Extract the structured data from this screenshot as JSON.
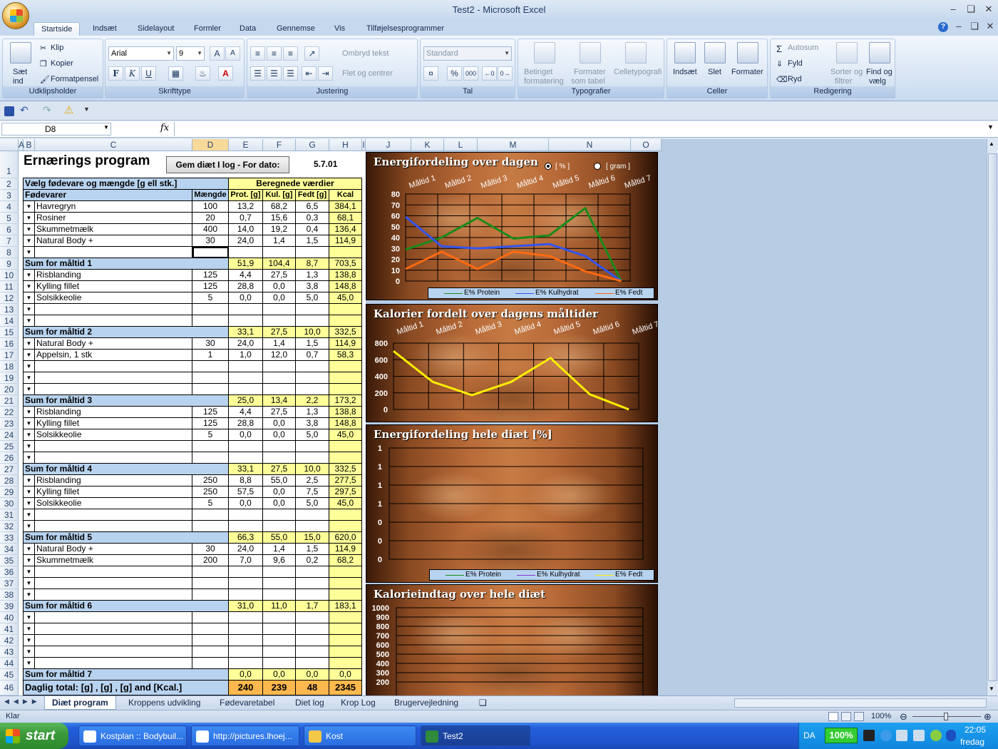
{
  "window": {
    "title": "Test2 - Microsoft Excel"
  },
  "ribbon_tabs": [
    "Startside",
    "Indsæt",
    "Sidelayout",
    "Formler",
    "Data",
    "Gennemse",
    "Vis",
    "Tilføjelsesprogrammer"
  ],
  "ribbon": {
    "clipboard": {
      "paste": "Sæt",
      "paste2": "ind",
      "cut": "Klip",
      "copy": "Kopier",
      "format_painter": "Formatpensel",
      "label": "Udklipsholder"
    },
    "font": {
      "name": "Arial",
      "size": "9",
      "label": "Skrifttype",
      "bold": "F",
      "italic": "K",
      "underline": "U",
      "font_color": "A"
    },
    "alignment": {
      "wrap": "Ombryd tekst",
      "merge": "Flet og centrer",
      "label": "Justering"
    },
    "number": {
      "format": "Standard",
      "label": "Tal",
      "percent": "%",
      "thousands": "000"
    },
    "styles": {
      "cond1": "Betinget",
      "cond2": "formatering",
      "table1": "Formater",
      "table2": "som tabel",
      "cell1": "Celletypografi",
      "label": "Typografier"
    },
    "cells": {
      "insert": "Indsæt",
      "delete": "Slet",
      "format": "Formater",
      "label": "Celler"
    },
    "editing": {
      "autosum": "Autosum",
      "fill": "Fyld",
      "clear": "Ryd",
      "sort1": "Sorter og",
      "sort2": "filtrer",
      "find1": "Find og",
      "find2": "vælg",
      "label": "Redigering",
      "sigma": "Σ"
    }
  },
  "namebox": "D8",
  "fx": "fx",
  "columns": [
    "A",
    "B",
    "C",
    "D",
    "E",
    "F",
    "G",
    "H",
    "I",
    "J",
    "K",
    "L",
    "M",
    "N",
    "O"
  ],
  "sheet": {
    "title": "Ernærings program",
    "button": "Gem diæt I log - For dato:",
    "date": "5.7.01",
    "r2_left": "Vælg fødevare og mængde [g ell stk.]",
    "r2_right": "Beregnede værdier",
    "hdr": [
      "Fødevarer",
      "Mængde",
      "Prot. [g]",
      "Kul. [g]",
      "Fedt [g]",
      "Kcal"
    ],
    "rows": [
      {
        "r": "4",
        "t": "f",
        "c": [
          "Havregryn",
          "100",
          "13,2",
          "68,2",
          "6,5",
          "384,1"
        ]
      },
      {
        "r": "5",
        "t": "f",
        "c": [
          "Rosiner",
          "20",
          "0,7",
          "15,6",
          "0,3",
          "68,1"
        ]
      },
      {
        "r": "6",
        "t": "f",
        "c": [
          "Skummetmælk",
          "400",
          "14,0",
          "19,2",
          "0,4",
          "136,4"
        ]
      },
      {
        "r": "7",
        "t": "f",
        "c": [
          "Natural Body +",
          "30",
          "24,0",
          "1,4",
          "1,5",
          "114,9"
        ]
      },
      {
        "r": "8",
        "t": "f",
        "c": [
          "",
          "",
          "",
          "",
          "",
          ""
        ]
      },
      {
        "r": "9",
        "t": "s",
        "c": [
          "Sum for måltid 1",
          "",
          "51,9",
          "104,4",
          "8,7",
          "703,5"
        ]
      },
      {
        "r": "10",
        "t": "f",
        "c": [
          "Risblanding",
          "125",
          "4,4",
          "27,5",
          "1,3",
          "138,8"
        ]
      },
      {
        "r": "11",
        "t": "f",
        "c": [
          "Kylling fillet",
          "125",
          "28,8",
          "0,0",
          "3,8",
          "148,8"
        ]
      },
      {
        "r": "12",
        "t": "f",
        "c": [
          "Solsikkeolie",
          "5",
          "0,0",
          "0,0",
          "5,0",
          "45,0"
        ]
      },
      {
        "r": "13",
        "t": "f",
        "c": [
          "",
          "",
          "",
          "",
          "",
          ""
        ]
      },
      {
        "r": "14",
        "t": "f",
        "c": [
          "",
          "",
          "",
          "",
          "",
          ""
        ]
      },
      {
        "r": "15",
        "t": "s",
        "c": [
          "Sum for måltid 2",
          "",
          "33,1",
          "27,5",
          "10,0",
          "332,5"
        ]
      },
      {
        "r": "16",
        "t": "f",
        "c": [
          "Natural Body +",
          "30",
          "24,0",
          "1,4",
          "1,5",
          "114,9"
        ]
      },
      {
        "r": "17",
        "t": "f",
        "c": [
          "Appelsin, 1 stk",
          "1",
          "1,0",
          "12,0",
          "0,7",
          "58,3"
        ]
      },
      {
        "r": "18",
        "t": "f",
        "c": [
          "",
          "",
          "",
          "",
          "",
          ""
        ]
      },
      {
        "r": "19",
        "t": "f",
        "c": [
          "",
          "",
          "",
          "",
          "",
          ""
        ]
      },
      {
        "r": "20",
        "t": "f",
        "c": [
          "",
          "",
          "",
          "",
          "",
          ""
        ]
      },
      {
        "r": "21",
        "t": "s",
        "c": [
          "Sum for måltid 3",
          "",
          "25,0",
          "13,4",
          "2,2",
          "173,2"
        ]
      },
      {
        "r": "22",
        "t": "f",
        "c": [
          "Risblanding",
          "125",
          "4,4",
          "27,5",
          "1,3",
          "138,8"
        ]
      },
      {
        "r": "23",
        "t": "f",
        "c": [
          "Kylling fillet",
          "125",
          "28,8",
          "0,0",
          "3,8",
          "148,8"
        ]
      },
      {
        "r": "24",
        "t": "f",
        "c": [
          "Solsikkeolie",
          "5",
          "0,0",
          "0,0",
          "5,0",
          "45,0"
        ]
      },
      {
        "r": "25",
        "t": "f",
        "c": [
          "",
          "",
          "",
          "",
          "",
          ""
        ]
      },
      {
        "r": "26",
        "t": "f",
        "c": [
          "",
          "",
          "",
          "",
          "",
          ""
        ]
      },
      {
        "r": "27",
        "t": "s",
        "c": [
          "Sum for måltid 4",
          "",
          "33,1",
          "27,5",
          "10,0",
          "332,5"
        ]
      },
      {
        "r": "28",
        "t": "f",
        "c": [
          "Risblanding",
          "250",
          "8,8",
          "55,0",
          "2,5",
          "277,5"
        ]
      },
      {
        "r": "29",
        "t": "f",
        "c": [
          "Kylling fillet",
          "250",
          "57,5",
          "0,0",
          "7,5",
          "297,5"
        ]
      },
      {
        "r": "30",
        "t": "f",
        "c": [
          "Solsikkeolie",
          "5",
          "0,0",
          "0,0",
          "5,0",
          "45,0"
        ]
      },
      {
        "r": "31",
        "t": "f",
        "c": [
          "",
          "",
          "",
          "",
          "",
          ""
        ]
      },
      {
        "r": "32",
        "t": "f",
        "c": [
          "",
          "",
          "",
          "",
          "",
          ""
        ]
      },
      {
        "r": "33",
        "t": "s",
        "c": [
          "Sum for måltid 5",
          "",
          "66,3",
          "55,0",
          "15,0",
          "620,0"
        ]
      },
      {
        "r": "34",
        "t": "f",
        "c": [
          "Natural Body +",
          "30",
          "24,0",
          "1,4",
          "1,5",
          "114,9"
        ]
      },
      {
        "r": "35",
        "t": "f",
        "c": [
          "Skummetmælk",
          "200",
          "7,0",
          "9,6",
          "0,2",
          "68,2"
        ]
      },
      {
        "r": "36",
        "t": "f",
        "c": [
          "",
          "",
          "",
          "",
          "",
          ""
        ]
      },
      {
        "r": "37",
        "t": "f",
        "c": [
          "",
          "",
          "",
          "",
          "",
          ""
        ]
      },
      {
        "r": "38",
        "t": "f",
        "c": [
          "",
          "",
          "",
          "",
          "",
          ""
        ]
      },
      {
        "r": "39",
        "t": "s",
        "c": [
          "Sum for måltid 6",
          "",
          "31,0",
          "11,0",
          "1,7",
          "183,1"
        ]
      },
      {
        "r": "40",
        "t": "f",
        "c": [
          "",
          "",
          "",
          "",
          "",
          ""
        ]
      },
      {
        "r": "41",
        "t": "f",
        "c": [
          "",
          "",
          "",
          "",
          "",
          ""
        ]
      },
      {
        "r": "42",
        "t": "f",
        "c": [
          "",
          "",
          "",
          "",
          "",
          ""
        ]
      },
      {
        "r": "43",
        "t": "f",
        "c": [
          "",
          "",
          "",
          "",
          "",
          ""
        ]
      },
      {
        "r": "44",
        "t": "f",
        "c": [
          "",
          "",
          "",
          "",
          "",
          ""
        ]
      },
      {
        "r": "45",
        "t": "s",
        "c": [
          "Sum for måltid 7",
          "",
          "0,0",
          "0,0",
          "0,0",
          "0,0"
        ]
      },
      {
        "r": "46",
        "t": "t",
        "c": [
          "Daglig total: [g] , [g] , [g] and [Kcal.]",
          "",
          "240",
          "239",
          "48",
          "2345"
        ]
      }
    ]
  },
  "chart_data": [
    {
      "type": "line",
      "title": "Energifordeling over dagen",
      "categories": [
        "Måltid 1",
        "Måltid 2",
        "Måltid 3",
        "Måltid 4",
        "Måltid 5",
        "Måltid 6",
        "Måltid 7"
      ],
      "ylim": [
        0,
        80
      ],
      "yticks": [
        0,
        10,
        20,
        30,
        40,
        50,
        60,
        70,
        80
      ],
      "radio": {
        "opt1": "[ % ]",
        "opt2": "[ gram ]"
      },
      "series": [
        {
          "name": "E% Protein",
          "color": "#1a8a1a",
          "values": [
            29,
            40,
            58,
            39,
            42,
            67,
            0
          ]
        },
        {
          "name": "E% Kulhydrat",
          "color": "#3355ee",
          "values": [
            59,
            32,
            30,
            32,
            34,
            23,
            0
          ]
        },
        {
          "name": "E% Fedt",
          "color": "#ff6a10",
          "values": [
            11,
            27,
            11,
            27,
            23,
            9,
            0
          ]
        }
      ]
    },
    {
      "type": "line",
      "title": "Kalorier fordelt over dagens måltider",
      "categories": [
        "Måltid 1",
        "Måltid 2",
        "Måltid 3",
        "Måltid 4",
        "Måltid 5",
        "Måltid 6",
        "Måltid 7"
      ],
      "ylim": [
        0,
        800
      ],
      "yticks": [
        0,
        200,
        400,
        600,
        800
      ],
      "series": [
        {
          "name": "Kcal",
          "color": "#ffee00",
          "values": [
            703.5,
            332.5,
            173.2,
            332.5,
            620.0,
            183.1,
            0
          ]
        }
      ]
    },
    {
      "type": "line",
      "title": "Energifordeling hele diæt [%]",
      "yticks_labels": [
        "0",
        "0",
        "0",
        "1",
        "1",
        "1",
        "1"
      ],
      "series": [
        {
          "name": "E% Protein",
          "color": "#1a8a1a",
          "values": []
        },
        {
          "name": "E% Kulhydrat",
          "color": "#8833cc",
          "values": []
        },
        {
          "name": "E% Fedt",
          "color": "#ffee00",
          "values": []
        }
      ]
    },
    {
      "type": "line",
      "title": "Kalorieindtag over hele diæt",
      "yticks": [
        200,
        300,
        400,
        500,
        600,
        700,
        800,
        900,
        1000
      ],
      "series": []
    }
  ],
  "sheet_tabs": [
    "Diæt program",
    "Kroppens udvikling",
    "Fødevaretabel",
    "Diet log",
    "Krop Log",
    "Brugervejledning"
  ],
  "status": {
    "ready": "Klar",
    "zoom": "100%"
  },
  "taskbar": {
    "start": "start",
    "items": [
      "Kostplan :: Bodybuil...",
      "http://pictures.lhoej...",
      "Kost",
      "Test2"
    ],
    "lang": "DA",
    "battery": "100%",
    "time": "22:05",
    "day": "fredag"
  }
}
